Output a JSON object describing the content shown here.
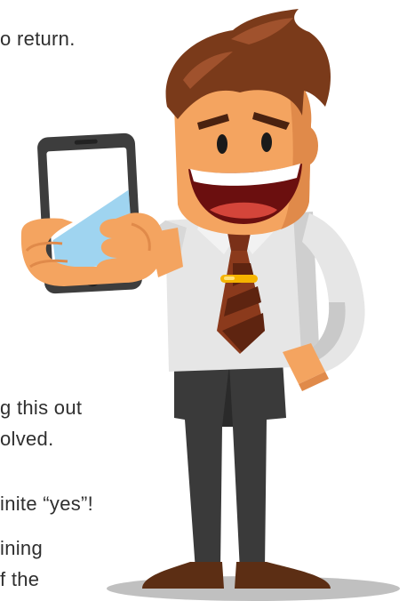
{
  "text_fragments": {
    "line_1": "o return.",
    "line_2": "g this out",
    "line_3": "olved.",
    "line_4": "inite “yes”!",
    "line_5": "ining",
    "line_6": "f the"
  },
  "illustration": {
    "subject": "cartoon businessman holding smartphone",
    "colors": {
      "hair": "#7a3a1a",
      "hair_highlight": "#a0522d",
      "skin": "#f4a460",
      "skin_shadow": "#e08a4a",
      "shirt": "#e6e6e6",
      "shirt_shadow": "#c9c9c9",
      "tie": "#8b3a1c",
      "tie_stripe": "#5e2410",
      "tie_clip": "#f5b400",
      "trousers": "#3a3a3a",
      "shoes": "#5c2e14",
      "phone_body": "#3d3d3d",
      "phone_screen": "#ffffff",
      "phone_glare": "#9fd4f0",
      "mouth": "#6b0f0f",
      "tongue": "#d4453a",
      "teeth": "#ffffff",
      "eye": "#1a1a1a",
      "ground_shadow": "#b5b5b5"
    }
  }
}
